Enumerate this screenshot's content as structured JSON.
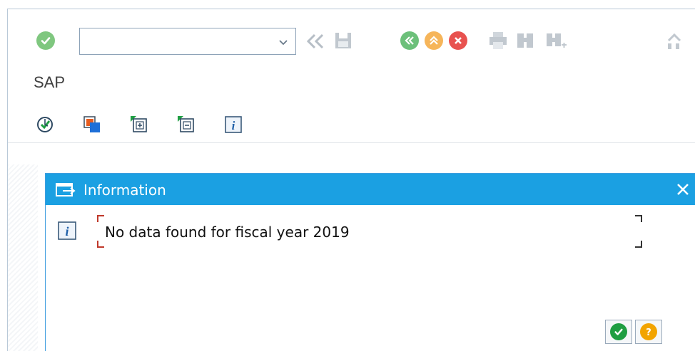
{
  "app_title": "SAP",
  "toolbar": {
    "command_field_value": "",
    "icons": [
      "enter-icon",
      "chevron-down-icon",
      "double-left-icon",
      "save-icon",
      "back-icon",
      "exit-icon",
      "cancel-icon",
      "print-icon",
      "find-icon",
      "find-next-icon",
      "first-page-icon"
    ]
  },
  "app_toolbar": {
    "icons": [
      "execute-icon",
      "copy-variant-icon",
      "expand-icon",
      "collapse-icon",
      "info-icon"
    ]
  },
  "dialog": {
    "title": "Information",
    "message": "No data found for fiscal year 2019",
    "buttons": [
      "confirm-icon",
      "help-icon"
    ]
  },
  "colors": {
    "dialog_header": "#1ba0e2",
    "confirm_green": "#1f9e42",
    "help_orange": "#f2a400",
    "cancel_red": "#e8524f",
    "exit_orange": "#f6b55a",
    "back_green": "#6cc07a"
  }
}
